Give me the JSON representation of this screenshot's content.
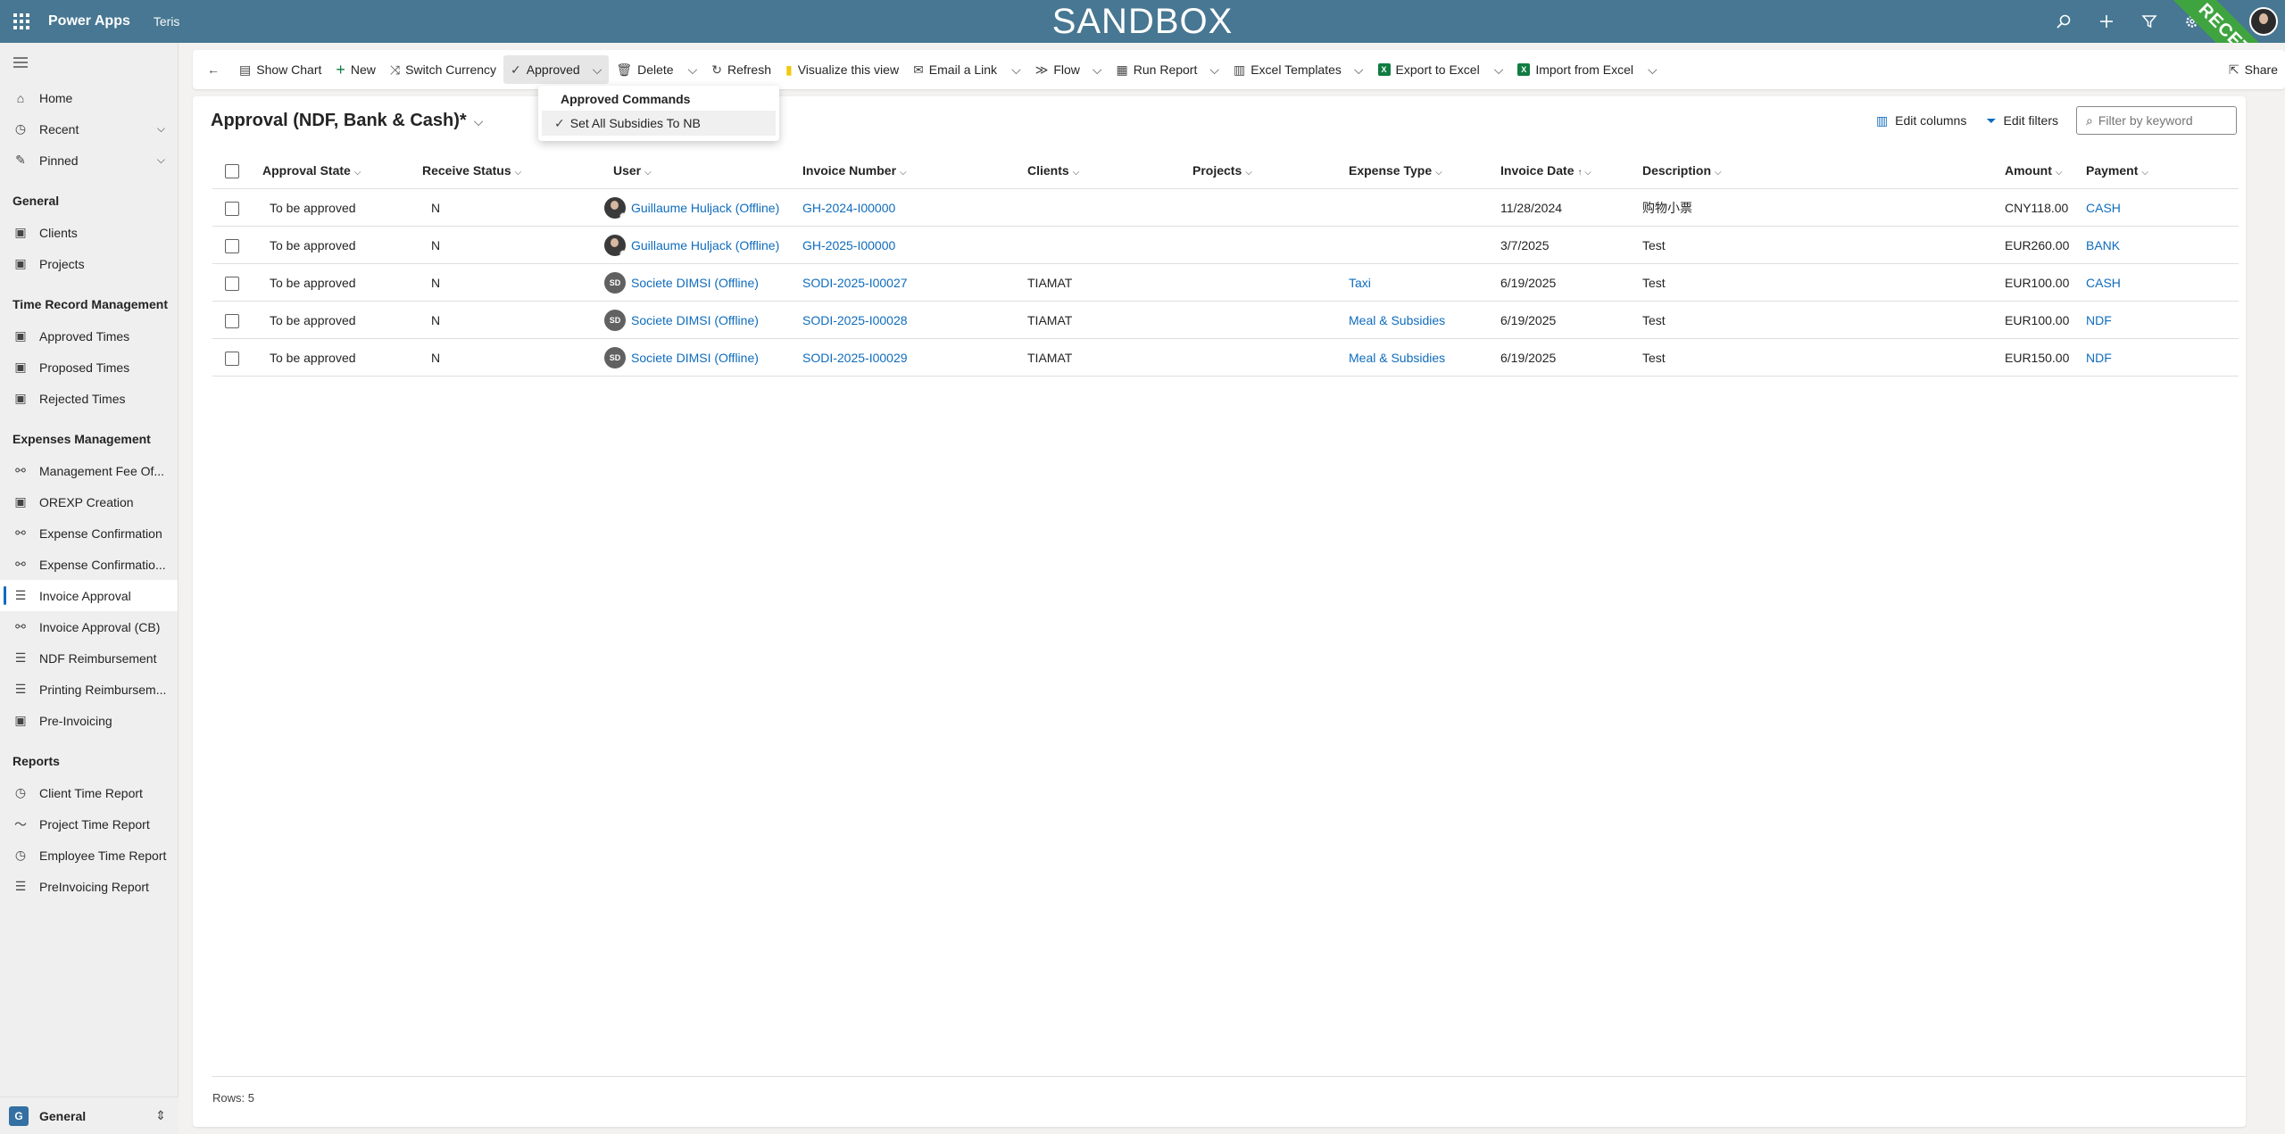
{
  "header": {
    "app_name": "Power Apps",
    "environment": "Teris",
    "banner": "SANDBOX",
    "ribbon": "RECETTE"
  },
  "sidebar": {
    "top_items": [
      {
        "label": "Home",
        "icon": "home-icon"
      },
      {
        "label": "Recent",
        "icon": "clock-icon"
      },
      {
        "label": "Pinned",
        "icon": "pin-icon"
      }
    ],
    "groups": [
      {
        "title": "General",
        "items": [
          {
            "label": "Clients",
            "icon": "entity-icon"
          },
          {
            "label": "Projects",
            "icon": "entity-icon"
          }
        ]
      },
      {
        "title": "Time Record Management",
        "items": [
          {
            "label": "Approved Times",
            "icon": "entity-icon"
          },
          {
            "label": "Proposed Times",
            "icon": "entity-icon"
          },
          {
            "label": "Rejected Times",
            "icon": "entity-icon"
          }
        ]
      },
      {
        "title": "Expenses Management",
        "items": [
          {
            "label": "Management Fee Of...",
            "icon": "flow-icon"
          },
          {
            "label": "OREXP Creation",
            "icon": "entity-icon"
          },
          {
            "label": "Expense Confirmation",
            "icon": "flow-icon"
          },
          {
            "label": "Expense Confirmatio...",
            "icon": "flow-icon"
          },
          {
            "label": "Invoice Approval",
            "icon": "document-icon",
            "active": true
          },
          {
            "label": "Invoice Approval (CB)",
            "icon": "flow-icon"
          },
          {
            "label": "NDF Reimbursement",
            "icon": "document-icon"
          },
          {
            "label": "Printing Reimbursem...",
            "icon": "document-icon"
          },
          {
            "label": "Pre-Invoicing",
            "icon": "entity-icon"
          }
        ]
      },
      {
        "title": "Reports",
        "items": [
          {
            "label": "Client Time Report",
            "icon": "clock-icon"
          },
          {
            "label": "Project Time Report",
            "icon": "chart-line-icon"
          },
          {
            "label": "Employee Time Report",
            "icon": "clock-icon"
          },
          {
            "label": "PreInvoicing Report",
            "icon": "document-icon"
          }
        ]
      }
    ],
    "area": {
      "badge": "G",
      "label": "General"
    }
  },
  "commandbar": {
    "show_chart": "Show Chart",
    "new": "New",
    "switch_currency": "Switch Currency",
    "approved": "Approved",
    "delete": "Delete",
    "refresh": "Refresh",
    "visualize": "Visualize this view",
    "email_link": "Email a Link",
    "flow": "Flow",
    "run_report": "Run Report",
    "excel_templates": "Excel Templates",
    "export_excel": "Export to Excel",
    "import_excel": "Import from Excel",
    "share": "Share"
  },
  "dropdown": {
    "header": "Approved Commands",
    "item": "Set All Subsidies To NB"
  },
  "view": {
    "title": "Approval (NDF, Bank & Cash)*",
    "edit_columns": "Edit columns",
    "edit_filters": "Edit filters",
    "filter_placeholder": "Filter by keyword"
  },
  "table": {
    "columns": {
      "approval_state": "Approval State",
      "receive_status": "Receive Status",
      "user": "User",
      "invoice_number": "Invoice Number",
      "clients": "Clients",
      "projects": "Projects",
      "expense_type": "Expense Type",
      "invoice_date": "Invoice Date",
      "description": "Description",
      "amount": "Amount",
      "payment": "Payment"
    },
    "rows": [
      {
        "approval_state": "To be approved",
        "receive_status": "N",
        "user": "Guillaume Huljack (Offline)",
        "avatar": "photo",
        "invoice_number": "GH-2024-I00000",
        "clients": "",
        "projects": "",
        "expense_type": "",
        "invoice_date": "11/28/2024",
        "description": "购物小票",
        "amount": "CNY118.00",
        "payment": "CASH"
      },
      {
        "approval_state": "To be approved",
        "receive_status": "N",
        "user": "Guillaume Huljack (Offline)",
        "avatar": "photo",
        "invoice_number": "GH-2025-I00000",
        "clients": "",
        "projects": "",
        "expense_type": "",
        "invoice_date": "3/7/2025",
        "description": "Test",
        "amount": "EUR260.00",
        "payment": "BANK"
      },
      {
        "approval_state": "To be approved",
        "receive_status": "N",
        "user": "Societe DIMSI (Offline)",
        "avatar": "SD",
        "invoice_number": "SODI-2025-I00027",
        "clients": "TIAMAT",
        "projects": "",
        "expense_type": "Taxi",
        "invoice_date": "6/19/2025",
        "description": "Test",
        "amount": "EUR100.00",
        "payment": "CASH"
      },
      {
        "approval_state": "To be approved",
        "receive_status": "N",
        "user": "Societe DIMSI (Offline)",
        "avatar": "SD",
        "invoice_number": "SODI-2025-I00028",
        "clients": "TIAMAT",
        "projects": "",
        "expense_type": "Meal & Subsidies",
        "invoice_date": "6/19/2025",
        "description": "Test",
        "amount": "EUR100.00",
        "payment": "NDF"
      },
      {
        "approval_state": "To be approved",
        "receive_status": "N",
        "user": "Societe DIMSI (Offline)",
        "avatar": "SD",
        "invoice_number": "SODI-2025-I00029",
        "clients": "TIAMAT",
        "projects": "",
        "expense_type": "Meal & Subsidies",
        "invoice_date": "6/19/2025",
        "description": "Test",
        "amount": "EUR150.00",
        "payment": "NDF"
      }
    ],
    "rows_count": "Rows: 5"
  },
  "colors": {
    "header_bg": "#477792",
    "link": "#0f6cbd",
    "ribbon": "#3fa43f"
  }
}
